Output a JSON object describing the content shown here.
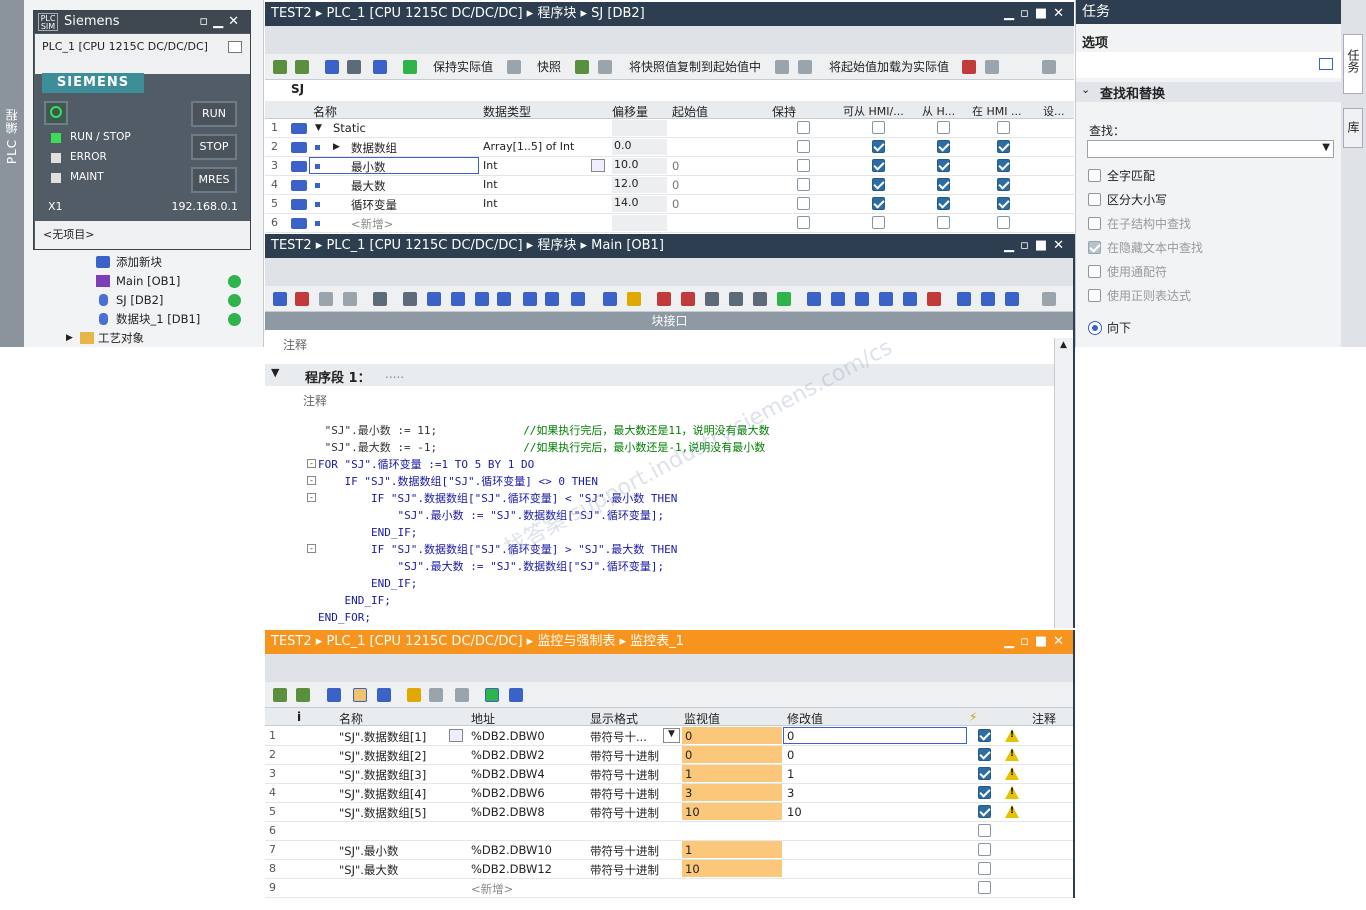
{
  "left_strip": {
    "label": "PLC 编程"
  },
  "tree": {
    "items": [
      {
        "label": "添加新块",
        "dot": false
      },
      {
        "label": "Main [OB1]",
        "dot": true
      },
      {
        "label": "SJ [DB2]",
        "dot": true
      },
      {
        "label": "数据块_1 [DB1]",
        "dot": true
      },
      {
        "label": "工艺对象",
        "dot": false
      }
    ]
  },
  "plcsim": {
    "title": "Siemens",
    "badge": "PLC SIM",
    "cpu": "PLC_1 [CPU 1215C DC/DC/DC]",
    "brand": "SIEMENS",
    "leds": [
      "RUN / STOP",
      "ERROR",
      "MAINT"
    ],
    "buttons": [
      "RUN",
      "STOP",
      "MRES"
    ],
    "iface": "X1",
    "ip": "192.168.0.1",
    "project": "<无项目>"
  },
  "db_window": {
    "breadcrumb": [
      "TEST2",
      "PLC_1 [CPU 1215C DC/DC/DC]",
      "程序块",
      "SJ [DB2]"
    ],
    "toolbar": {
      "keep_actual": "保持实际值",
      "snapshot": "快照",
      "copy_snapshot": "将快照值复制到起始值中",
      "load_start": "将起始值加载为实际值"
    },
    "db_name": "SJ",
    "columns": [
      "名称",
      "数据类型",
      "偏移量",
      "起始值",
      "保持",
      "可从 HMI/...",
      "从 H...",
      "在 HMI ...",
      "设..."
    ],
    "rows": [
      {
        "n": "1",
        "name": "Static",
        "type": "",
        "offset": "",
        "start": "",
        "keep": false,
        "hmi1": false,
        "hmi2": false,
        "hmi3": false
      },
      {
        "n": "2",
        "name": "数据数组",
        "type": "Array[1..5] of Int",
        "offset": "0.0",
        "start": "",
        "keep": false,
        "hmi1": true,
        "hmi2": true,
        "hmi3": true
      },
      {
        "n": "3",
        "name": "最小数",
        "type": "Int",
        "offset": "10.0",
        "start": "0",
        "keep": false,
        "hmi1": true,
        "hmi2": true,
        "hmi3": true
      },
      {
        "n": "4",
        "name": "最大数",
        "type": "Int",
        "offset": "12.0",
        "start": "0",
        "keep": false,
        "hmi1": true,
        "hmi2": true,
        "hmi3": true
      },
      {
        "n": "5",
        "name": "循环变量",
        "type": "Int",
        "offset": "14.0",
        "start": "0",
        "keep": false,
        "hmi1": true,
        "hmi2": true,
        "hmi3": true
      },
      {
        "n": "6",
        "name": "<新增>",
        "type": "",
        "offset": "",
        "start": "",
        "keep": false,
        "hmi1": false,
        "hmi2": false,
        "hmi3": false
      }
    ]
  },
  "ob_window": {
    "breadcrumb": [
      "TEST2",
      "PLC_1 [CPU 1215C DC/DC/DC]",
      "程序块",
      "Main [OB1]"
    ],
    "interface_label": "块接口",
    "comment_label": "注释",
    "network_title": "程序段 1：",
    "network_sub": ".....",
    "network_comment": "注释",
    "code": [
      {
        "t": " \"SJ\".最小数 := 11;             //如果执行完后，最大数还是11，说明没有最大数"
      },
      {
        "t": " \"SJ\".最大数 := -1;             //如果执行完后，最小数还是-1,说明没有最小数"
      },
      {
        "t": "FOR \"SJ\".循环变量 :=1 TO 5 BY 1 DO"
      },
      {
        "t": "    IF \"SJ\".数据数组[\"SJ\".循环变量] <> 0 THEN"
      },
      {
        "t": "        IF \"SJ\".数据数组[\"SJ\".循环变量] < \"SJ\".最小数 THEN"
      },
      {
        "t": "            \"SJ\".最小数 := \"SJ\".数据数组[\"SJ\".循环变量];"
      },
      {
        "t": "        END_IF;"
      },
      {
        "t": "        IF \"SJ\".数据数组[\"SJ\".循环变量] > \"SJ\".最大数 THEN"
      },
      {
        "t": "            \"SJ\".最大数 := \"SJ\".数据数组[\"SJ\".循环变量];"
      },
      {
        "t": "        END_IF;"
      },
      {
        "t": "    END_IF;"
      },
      {
        "t": "END_FOR;"
      }
    ]
  },
  "watch_window": {
    "breadcrumb": [
      "TEST2",
      "PLC_1 [CPU 1215C DC/DC/DC]",
      "监控与强制表",
      "监控表_1"
    ],
    "columns": [
      "i",
      "名称",
      "地址",
      "显示格式",
      "监视值",
      "修改值",
      "⚡",
      "注释"
    ],
    "rows": [
      {
        "n": "1",
        "name": "\"SJ\".数据数组[1]",
        "addr": "%DB2.DBW0",
        "fmt": "带符号十...",
        "mon": "0",
        "mod": "0",
        "cb": true,
        "warn": true
      },
      {
        "n": "2",
        "name": "\"SJ\".数据数组[2]",
        "addr": "%DB2.DBW2",
        "fmt": "带符号十进制",
        "mon": "0",
        "mod": "0",
        "cb": true,
        "warn": true
      },
      {
        "n": "3",
        "name": "\"SJ\".数据数组[3]",
        "addr": "%DB2.DBW4",
        "fmt": "带符号十进制",
        "mon": "1",
        "mod": "1",
        "cb": true,
        "warn": true
      },
      {
        "n": "4",
        "name": "\"SJ\".数据数组[4]",
        "addr": "%DB2.DBW6",
        "fmt": "带符号十进制",
        "mon": "3",
        "mod": "3",
        "cb": true,
        "warn": true
      },
      {
        "n": "5",
        "name": "\"SJ\".数据数组[5]",
        "addr": "%DB2.DBW8",
        "fmt": "带符号十进制",
        "mon": "10",
        "mod": "10",
        "cb": true,
        "warn": true
      },
      {
        "n": "6",
        "name": "",
        "addr": "",
        "fmt": "",
        "mon": "",
        "mod": "",
        "cb": false,
        "warn": false
      },
      {
        "n": "7",
        "name": "\"SJ\".最小数",
        "addr": "%DB2.DBW10",
        "fmt": "带符号十进制",
        "mon": "1",
        "mod": "",
        "cb": false,
        "warn": false
      },
      {
        "n": "8",
        "name": "\"SJ\".最大数",
        "addr": "%DB2.DBW12",
        "fmt": "带符号十进制",
        "mon": "10",
        "mod": "",
        "cb": false,
        "warn": false
      },
      {
        "n": "9",
        "name": "",
        "addr": "<新增>",
        "fmt": "",
        "mon": "",
        "mod": "",
        "cb": false,
        "warn": false
      }
    ]
  },
  "task_panel": {
    "title": "任务",
    "options": "选项",
    "find_replace": "查找和替换",
    "find_label": "查找：",
    "checks": [
      {
        "label": "全字匹配",
        "enabled": true,
        "checked": false
      },
      {
        "label": "区分大小写",
        "enabled": true,
        "checked": false
      },
      {
        "label": "在子结构中查找",
        "enabled": false,
        "checked": false
      },
      {
        "label": "在隐藏文本中查找",
        "enabled": false,
        "checked": true
      },
      {
        "label": "使用通配符",
        "enabled": false,
        "checked": false
      },
      {
        "label": "使用正则表达式",
        "enabled": false,
        "checked": false
      }
    ],
    "direction_down": "向下",
    "side_tabs": [
      "任务",
      "库"
    ]
  },
  "watermark": "找答案 support.industry.siemens.com/cs"
}
